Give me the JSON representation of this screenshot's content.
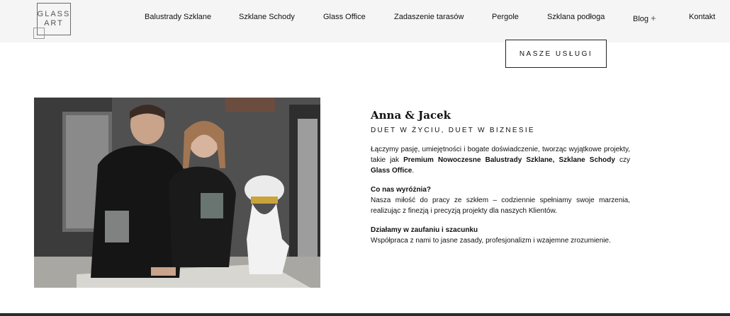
{
  "logo": {
    "line1": "GLASS",
    "line2": "ART"
  },
  "nav": {
    "items": [
      "Balustrady Szklane",
      "Szklane Schody",
      "Glass Office",
      "Zadaszenie tarasów",
      "Pergole",
      "Szklana podłoga",
      "Blog",
      "Kontakt"
    ],
    "blog_expand": "+"
  },
  "cta": {
    "label": "NASZE USŁUGI"
  },
  "about": {
    "title": "Anna & Jacek",
    "subtitle": "DUET W ŻYCIU, DUET W BIZNESIE",
    "intro": {
      "part1": "Łączymy pasję, umiejętności i bogate doświadczenie, tworząc wyjątkowe projekty, takie jak ",
      "bold1": "Premium Nowoczesne Balustrady Szklane, Szklane Schody",
      "part2": " czy ",
      "bold2": "Glass Office",
      "part3": "."
    },
    "blocks": [
      {
        "heading": "Co nas wyróżnia?",
        "text": "Nasza miłość do pracy ze szkłem – codziennie spełniamy swoje marzenia, realizując z finezją i precyzją projekty dla naszych Klientów."
      },
      {
        "heading": "Działamy w zaufaniu i szacunku",
        "text": "Współpraca z nami to jasne zasady, profesjonalizm i wzajemne zrozumienie."
      }
    ]
  }
}
